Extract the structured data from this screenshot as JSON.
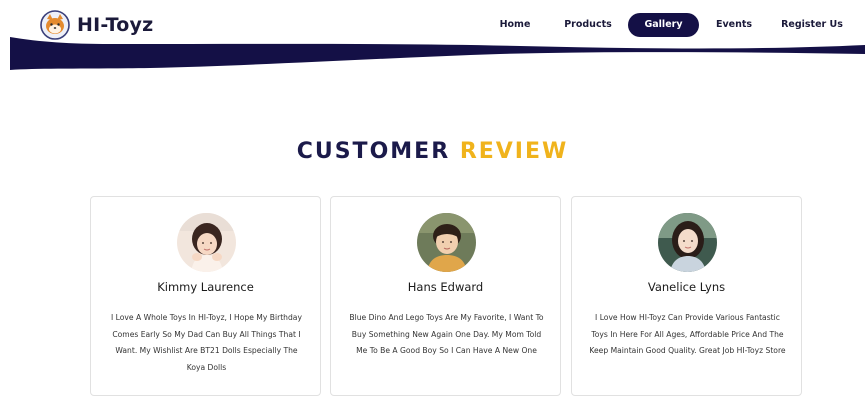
{
  "brand": {
    "name": "HI-Toyz"
  },
  "nav": {
    "items": [
      {
        "label": "Home"
      },
      {
        "label": "Products"
      },
      {
        "label": "Gallery"
      },
      {
        "label": "Events"
      },
      {
        "label": "Register Us"
      }
    ],
    "active": "Gallery"
  },
  "section": {
    "title_part1": "CUSTOMER",
    "title_part2": "REVIEW"
  },
  "reviews": [
    {
      "name": "Kimmy Laurence",
      "text": "I Love A Whole Toys In HI-Toyz, I Hope My Birthday Comes Early So My Dad Can Buy All Things That I Want. My Wishlist Are BT21 Dolls Especially The Koya Dolls"
    },
    {
      "name": "Hans Edward",
      "text": "Blue Dino And Lego Toys Are My Favorite, I Want To Buy Something New Again One Day. My Mom Told Me To Be A Good Boy So I Can Have A New One"
    },
    {
      "name": "Vanelice Lyns",
      "text": "I Love How HI-Toyz Can Provide Various Fantastic Toys In Here For All Ages, Affordable Price And The Keep Maintain Good Quality. Great Job HI-Toyz Store"
    }
  ],
  "colors": {
    "navy": "#141046",
    "gold": "#f0b31c"
  }
}
